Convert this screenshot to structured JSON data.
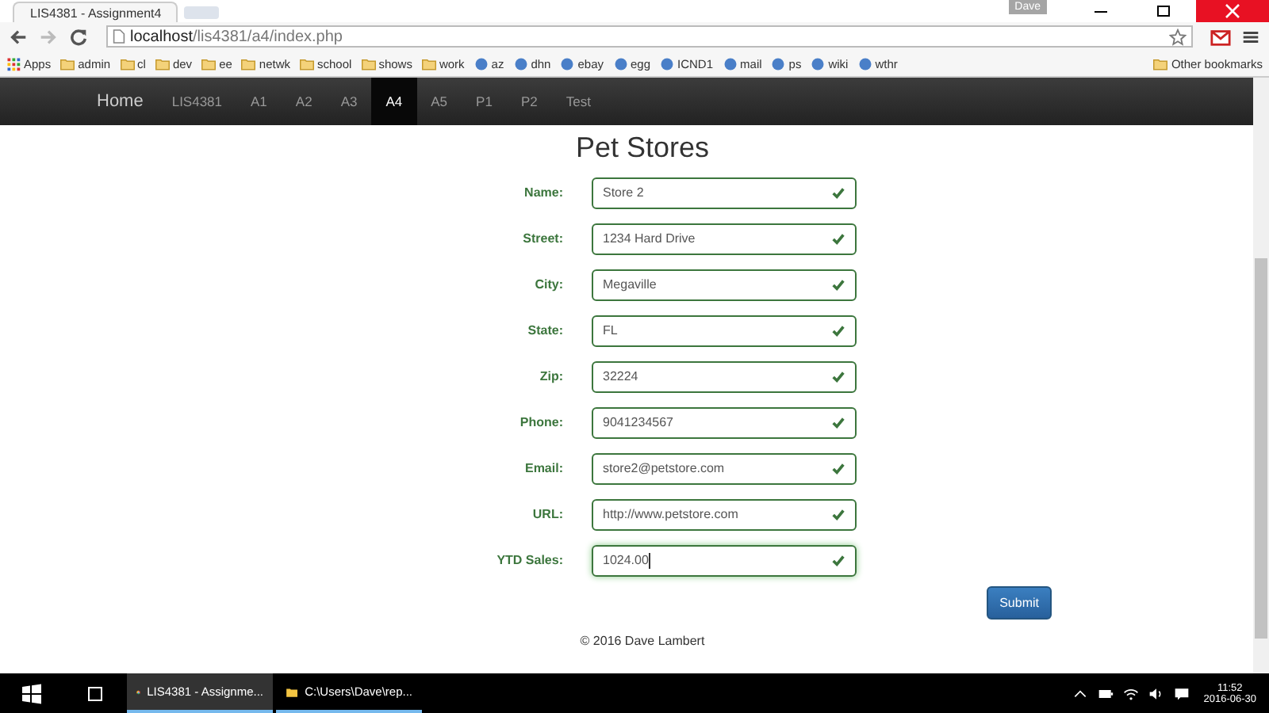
{
  "browser": {
    "tab_title": "LIS4381 - Assignment4",
    "user": "Dave",
    "url_host": "localhost",
    "url_path": "/lis4381/a4/index.php",
    "bookmarks": [
      {
        "label": "Apps",
        "kind": "apps"
      },
      {
        "label": "admin",
        "kind": "folder"
      },
      {
        "label": "cl",
        "kind": "folder"
      },
      {
        "label": "dev",
        "kind": "folder"
      },
      {
        "label": "ee",
        "kind": "folder"
      },
      {
        "label": "netwk",
        "kind": "folder"
      },
      {
        "label": "school",
        "kind": "folder"
      },
      {
        "label": "shows",
        "kind": "folder"
      },
      {
        "label": "work",
        "kind": "folder"
      },
      {
        "label": "az",
        "kind": "site"
      },
      {
        "label": "dhn",
        "kind": "site"
      },
      {
        "label": "ebay",
        "kind": "site"
      },
      {
        "label": "egg",
        "kind": "site"
      },
      {
        "label": "ICND1",
        "kind": "site"
      },
      {
        "label": "mail",
        "kind": "site"
      },
      {
        "label": "ps",
        "kind": "site"
      },
      {
        "label": "wiki",
        "kind": "site"
      },
      {
        "label": "wthr",
        "kind": "site"
      }
    ],
    "other_bookmarks": "Other bookmarks"
  },
  "navbar": {
    "brand": "Home",
    "items": [
      {
        "label": "LIS4381",
        "selected": false
      },
      {
        "label": "A1",
        "selected": false
      },
      {
        "label": "A2",
        "selected": false
      },
      {
        "label": "A3",
        "selected": false
      },
      {
        "label": "A4",
        "selected": true
      },
      {
        "label": "A5",
        "selected": false
      },
      {
        "label": "P1",
        "selected": false
      },
      {
        "label": "P2",
        "selected": false
      },
      {
        "label": "Test",
        "selected": false
      }
    ]
  },
  "form": {
    "title": "Pet Stores",
    "fields": [
      {
        "label": "Name:",
        "value": "Store 2",
        "valid": true,
        "focused": false
      },
      {
        "label": "Street:",
        "value": "1234 Hard Drive",
        "valid": true,
        "focused": false
      },
      {
        "label": "City:",
        "value": "Megaville",
        "valid": true,
        "focused": false
      },
      {
        "label": "State:",
        "value": "FL",
        "valid": true,
        "focused": false
      },
      {
        "label": "Zip:",
        "value": "32224",
        "valid": true,
        "focused": false
      },
      {
        "label": "Phone:",
        "value": "9041234567",
        "valid": true,
        "focused": false
      },
      {
        "label": "Email:",
        "value": "store2@petstore.com",
        "valid": true,
        "focused": false
      },
      {
        "label": "URL:",
        "value": "http://www.petstore.com",
        "valid": true,
        "focused": false
      },
      {
        "label": "YTD Sales:",
        "value": "1024.00",
        "valid": true,
        "focused": true
      }
    ],
    "submit": "Submit"
  },
  "footer": "© 2016 Dave Lambert",
  "taskbar": {
    "apps": [
      {
        "label": "LIS4381 - Assignme...",
        "kind": "browser",
        "selected": true
      },
      {
        "label": "C:\\Users\\Dave\\rep...",
        "kind": "folder",
        "selected": false
      }
    ],
    "time": "11:52",
    "date": "2016-06-30"
  }
}
